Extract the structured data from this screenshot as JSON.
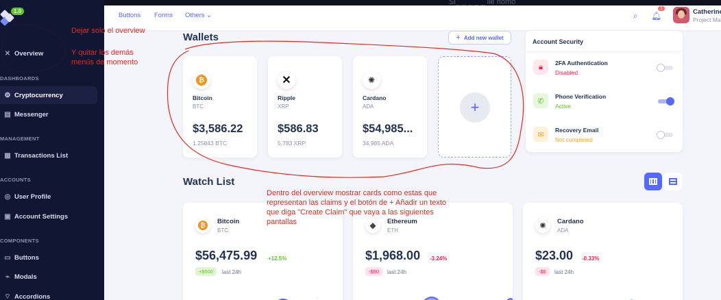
{
  "sidebar": {
    "logo_badge": "1.0",
    "items": [
      {
        "label": "Overview"
      },
      {
        "label": "Cryptocurrency"
      },
      {
        "label": "Messenger"
      },
      {
        "label": "Transactions List"
      },
      {
        "label": "User Profile"
      },
      {
        "label": "Account Settings"
      },
      {
        "label": "Buttons"
      },
      {
        "label": "Modals"
      },
      {
        "label": "Accordions"
      }
    ],
    "headings": {
      "dashboards": "DASHBOARDS",
      "management": "MANAGEMENT",
      "accounts": "ACCOUNTS",
      "components": "COMPONENTS"
    }
  },
  "header": {
    "nav": [
      "Buttons",
      "Forms",
      "Others"
    ],
    "notification_count": "1",
    "user_name": "Catherine",
    "user_role": "Project Ma",
    "strip_text": "Si_ _ _ _ _ lle homo"
  },
  "wallets": {
    "title": "Wallets",
    "add_label": "Add new wallet",
    "cards": [
      {
        "name": "Bitcoin",
        "symbol": "BTC",
        "value": "$3,586.22",
        "amount": "1.25843 BTC"
      },
      {
        "name": "Ripple",
        "symbol": "XRP",
        "value": "$586.83",
        "amount": "5,783 XRP"
      },
      {
        "name": "Cardano",
        "symbol": "ADA",
        "value": "$54,985...",
        "amount": "34,985 ADA"
      }
    ]
  },
  "security": {
    "title": "Account Security",
    "items": [
      {
        "name": "2FA Authentication",
        "status": "Disabled",
        "status_color": "#ff1943",
        "enabled": false
      },
      {
        "name": "Phone Verification",
        "status": "Active",
        "status_color": "#57ca22",
        "enabled": true
      },
      {
        "name": "Recovery Email",
        "status": "Not completed",
        "status_color": "#ffa319",
        "enabled": false
      }
    ]
  },
  "watchlist": {
    "title": "Watch List",
    "cards": [
      {
        "name": "Bitcoin",
        "symbol": "BTC",
        "price": "$56,475.99",
        "change": "+12.5%",
        "delta": "+$500",
        "period": "last 24h",
        "up": true
      },
      {
        "name": "Ethereum",
        "symbol": "ETH",
        "price": "$1,968.00",
        "change": "-3.24%",
        "delta": "-$90",
        "period": "last 24h",
        "up": false
      },
      {
        "name": "Cardano",
        "symbol": "ADA",
        "price": "$23.00",
        "change": "-0.33%",
        "delta": "-$5",
        "period": "last 24h",
        "up": false
      }
    ]
  },
  "annotations": {
    "note1": "Dejar solo el overview",
    "note2_line1": "Y quitar los demás",
    "note2_line2": "menús de momento",
    "note3_line1": "Dentro del overview mostrar cards como estas que",
    "note3_line2": "representan las claims y el botón de + Añadir un texto",
    "note3_line3": "que diga \"Create Claim\" que vaya a las siguientes",
    "note3_line4": "pantallas"
  },
  "colors": {
    "primary": "#5569ff",
    "sidebar_bg": "#111633",
    "annotation": "#e22b1e",
    "success": "#57ca22",
    "error": "#ff1943",
    "warning": "#ffa319"
  }
}
